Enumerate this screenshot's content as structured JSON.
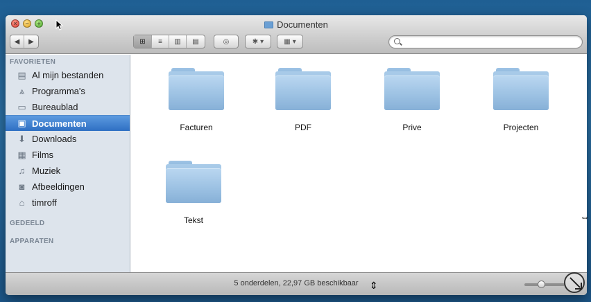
{
  "window": {
    "title": "Documenten"
  },
  "toolbar": {
    "back_glyph": "◀",
    "forward_glyph": "▶",
    "view_icon": "⊞",
    "list_icon": "≡",
    "column_icon": "▥",
    "coverflow_icon": "▤",
    "eye_icon": "◎",
    "gear_icon": "✱",
    "arrange_icon": "▦",
    "dropdown_glyph": "▾"
  },
  "search": {
    "value": "",
    "placeholder": ""
  },
  "sidebar": {
    "favorites_header": "FAVORIETEN",
    "items": [
      {
        "label": "Al mijn bestanden",
        "icon": "▤"
      },
      {
        "label": "Programma's",
        "icon": "⩓"
      },
      {
        "label": "Bureaublad",
        "icon": "▭"
      },
      {
        "label": "Documenten",
        "icon": "▣"
      },
      {
        "label": "Downloads",
        "icon": "⬇"
      },
      {
        "label": "Films",
        "icon": "▦"
      },
      {
        "label": "Muziek",
        "icon": "♫"
      },
      {
        "label": "Afbeeldingen",
        "icon": "◙"
      },
      {
        "label": "timroff",
        "icon": "⌂"
      }
    ],
    "shared_header": "GEDEELD",
    "devices_header": "APPARATEN"
  },
  "files": [
    {
      "name": "Facturen"
    },
    {
      "name": "PDF"
    },
    {
      "name": "Prive"
    },
    {
      "name": "Projecten"
    },
    {
      "name": "Tekst"
    }
  ],
  "status": {
    "text": "5 onderdelen, 22,97 GB beschikbaar"
  },
  "icon_size_level": 0.4
}
